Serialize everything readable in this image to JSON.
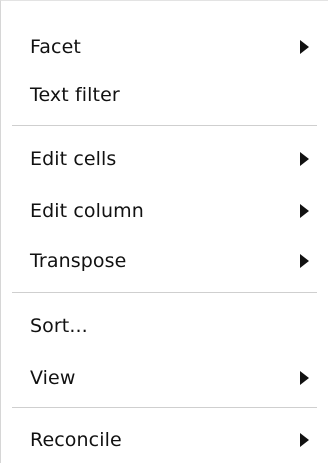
{
  "menu": {
    "items": [
      {
        "label": "Facet",
        "submenu": true
      },
      {
        "label": "Text filter",
        "submenu": false
      },
      {
        "label": "Edit cells",
        "submenu": true
      },
      {
        "label": "Edit column",
        "submenu": true
      },
      {
        "label": "Transpose",
        "submenu": true
      },
      {
        "label": "Sort...",
        "submenu": false
      },
      {
        "label": "View",
        "submenu": true
      },
      {
        "label": "Reconcile",
        "submenu": true
      }
    ],
    "colors": {
      "text": "#111111",
      "separator": "#cfcfcf",
      "background": "#ffffff"
    }
  }
}
